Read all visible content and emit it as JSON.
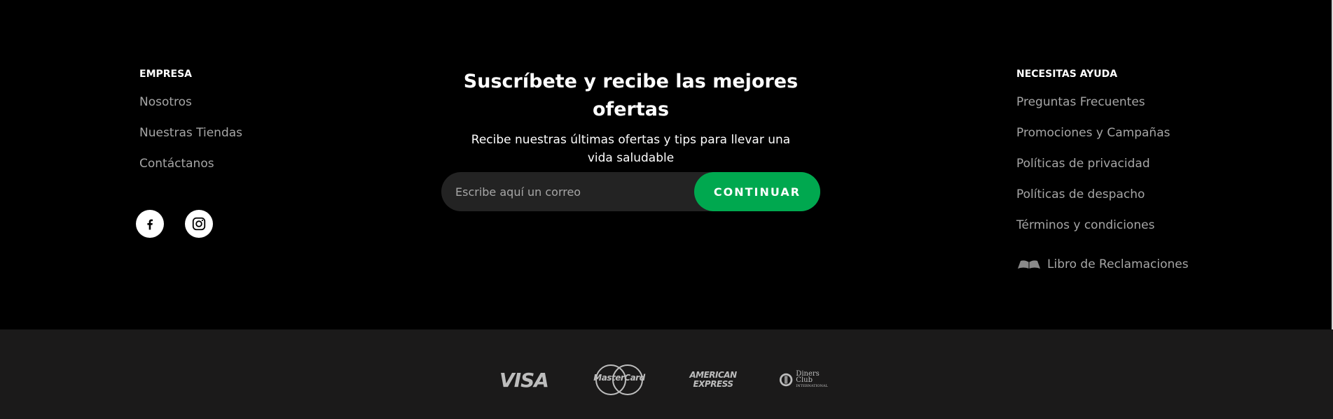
{
  "company": {
    "heading": "EMPRESA",
    "links": [
      "Nosotros",
      "Nuestras Tiendas",
      "Contáctanos"
    ]
  },
  "social": {
    "facebook_icon": "facebook-icon",
    "instagram_icon": "instagram-icon"
  },
  "newsletter": {
    "title": "Suscríbete y recibe las mejores ofertas",
    "subtitle": "Recibe nuestras últimas ofertas y tips para llevar una vida saludable",
    "email_placeholder": "Escribe aquí un correo",
    "email_value": "",
    "button_label": "CONTINUAR"
  },
  "help": {
    "heading": "NECESITAS AYUDA",
    "links": [
      "Preguntas Frecuentes",
      "Promociones y Campañas",
      "Políticas de privacidad",
      "Políticas de despacho",
      "Términos y condiciones",
      "Libro de Reclamaciones"
    ]
  },
  "payments": {
    "visa": "VISA",
    "mastercard": "MasterCard",
    "amex_line1": "AMERICAN",
    "amex_line2": "EXPRESS",
    "diners_line1": "Diners Club",
    "diners_line2": "INTERNATIONAL"
  },
  "colors": {
    "background": "#000000",
    "bottom_bar": "#1b1a1a",
    "accent": "#00a84f",
    "link": "#a6a6a6"
  }
}
